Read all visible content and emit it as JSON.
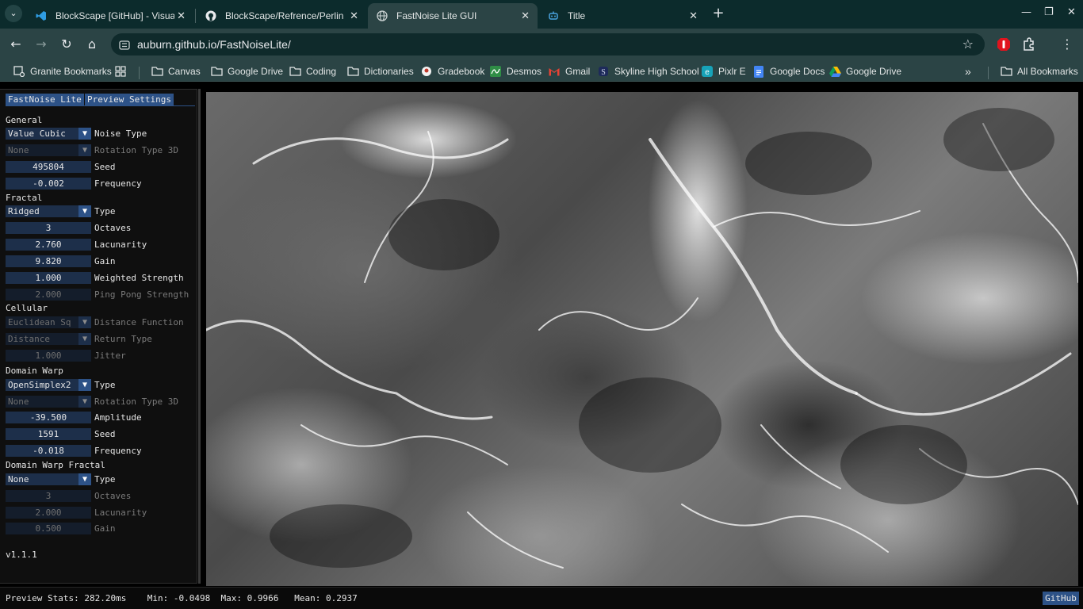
{
  "browser": {
    "tabs": [
      {
        "title": "BlockScape [GitHub] - Visual Studio Code",
        "icon": "vscode-icon"
      },
      {
        "title": "BlockScape/Refrence/Perlin Noise",
        "icon": "github-icon"
      },
      {
        "title": "FastNoise Lite GUI",
        "icon": "globe-icon",
        "active": true
      },
      {
        "title": "Title",
        "icon": "app-icon"
      }
    ],
    "url": "auburn.github.io/FastNoiseLite/",
    "bookmarks": [
      {
        "label": "Granite Bookmarks",
        "icon": "bookmark-manager-icon"
      },
      {
        "label": "Canvas",
        "icon": "folder-icon"
      },
      {
        "label": "Google Drive",
        "icon": "folder-icon"
      },
      {
        "label": "Coding",
        "icon": "folder-icon"
      },
      {
        "label": "Dictionaries",
        "icon": "folder-icon"
      },
      {
        "label": "Gradebook",
        "icon": "gradebook-icon"
      },
      {
        "label": "Desmos",
        "icon": "desmos-icon"
      },
      {
        "label": "Gmail",
        "icon": "gmail-icon"
      },
      {
        "label": "Skyline High School",
        "icon": "school-icon"
      },
      {
        "label": "Pixlr E",
        "icon": "pixlr-icon"
      },
      {
        "label": "Google Docs",
        "icon": "docs-icon"
      },
      {
        "label": "Google Drive",
        "icon": "drive-icon"
      }
    ],
    "all_bookmarks": "All Bookmarks"
  },
  "panel": {
    "tabs": [
      "FastNoise Lite",
      "Preview Settings"
    ],
    "general": {
      "title": "General",
      "noise_type": {
        "value": "Value Cubic",
        "label": "Noise Type"
      },
      "rotation_type": {
        "value": "None",
        "label": "Rotation Type 3D"
      },
      "seed": {
        "value": "495804",
        "label": "Seed"
      },
      "frequency": {
        "value": "-0.002",
        "label": "Frequency"
      }
    },
    "fractal": {
      "title": "Fractal",
      "type": {
        "value": "Ridged",
        "label": "Type"
      },
      "octaves": {
        "value": "3",
        "label": "Octaves"
      },
      "lacunarity": {
        "value": "2.760",
        "label": "Lacunarity"
      },
      "gain": {
        "value": "9.820",
        "label": "Gain"
      },
      "weighted_strength": {
        "value": "1.000",
        "label": "Weighted Strength"
      },
      "ping_pong_strength": {
        "value": "2.000",
        "label": "Ping Pong Strength"
      }
    },
    "cellular": {
      "title": "Cellular",
      "distance_function": {
        "value": "Euclidean Sq",
        "label": "Distance Function"
      },
      "return_type": {
        "value": "Distance",
        "label": "Return Type"
      },
      "jitter": {
        "value": "1.000",
        "label": "Jitter"
      }
    },
    "domain_warp": {
      "title": "Domain Warp",
      "type": {
        "value": "OpenSimplex2",
        "label": "Type"
      },
      "rotation_type": {
        "value": "None",
        "label": "Rotation Type 3D"
      },
      "amplitude": {
        "value": "-39.500",
        "label": "Amplitude"
      },
      "seed": {
        "value": "1591",
        "label": "Seed"
      },
      "frequency": {
        "value": "-0.018",
        "label": "Frequency"
      }
    },
    "domain_warp_fractal": {
      "title": "Domain Warp Fractal",
      "type": {
        "value": "None",
        "label": "Type"
      },
      "octaves": {
        "value": "3",
        "label": "Octaves"
      },
      "lacunarity": {
        "value": "2.000",
        "label": "Lacunarity"
      },
      "gain": {
        "value": "0.500",
        "label": "Gain"
      }
    },
    "version": "v1.1.1"
  },
  "status": {
    "stats": "Preview Stats: 282.20ms    Min: -0.0498  Max: 0.9966   Mean: 0.2937",
    "github_button": "GitHub"
  }
}
